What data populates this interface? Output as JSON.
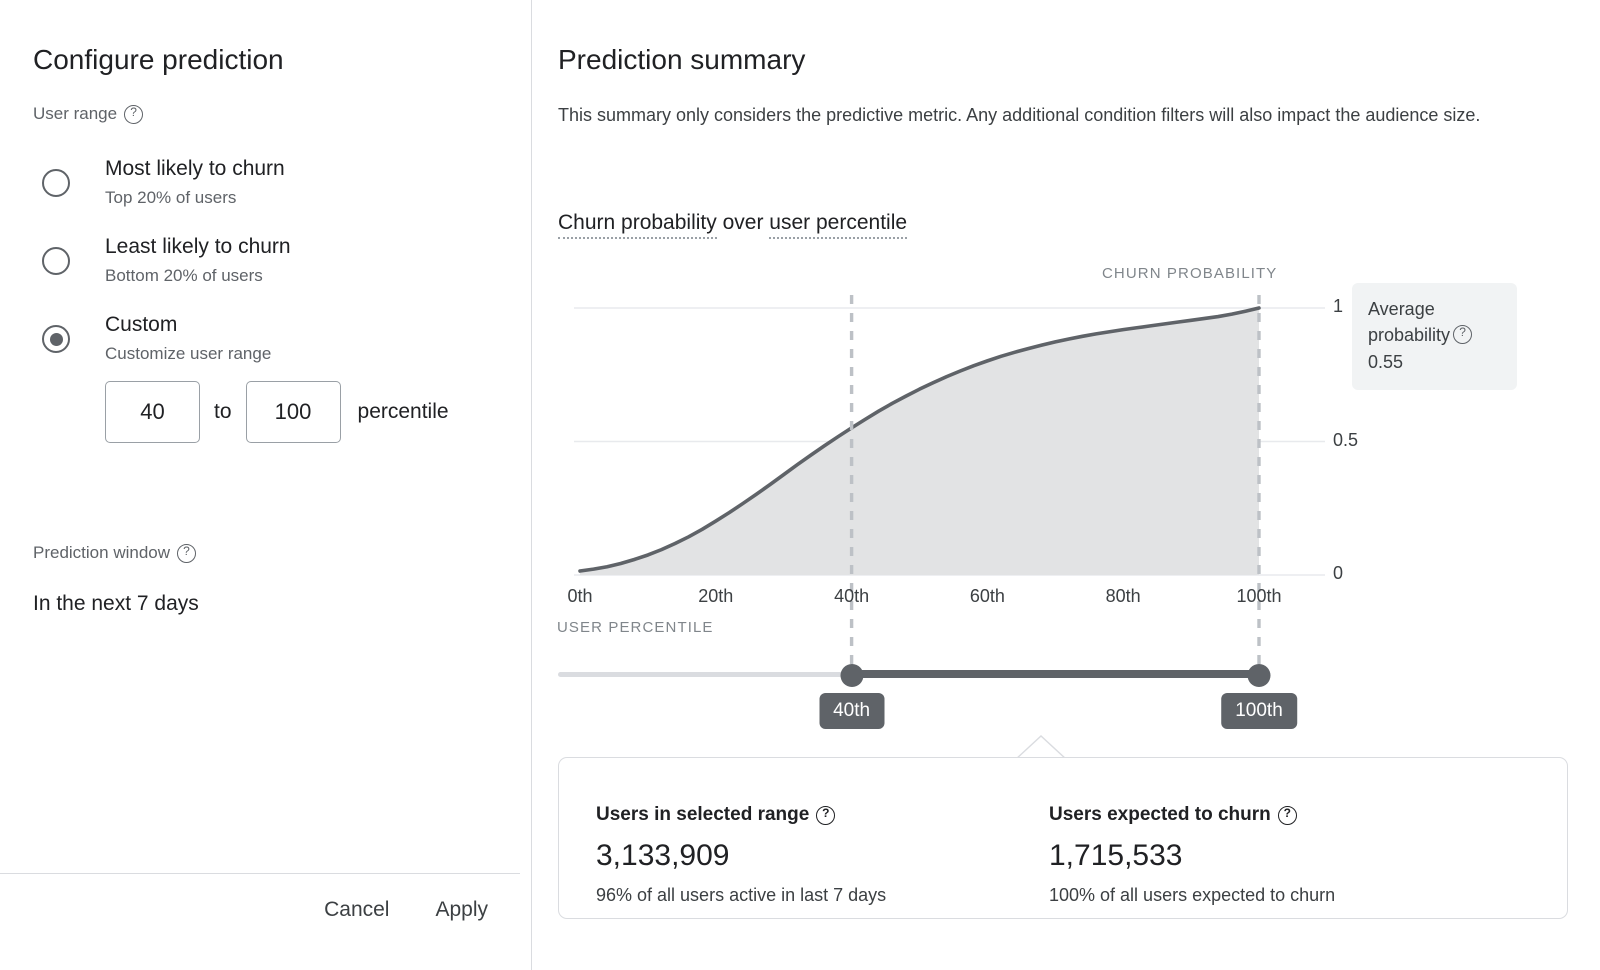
{
  "left": {
    "title": "Configure prediction",
    "user_range_label": "User range",
    "help_icon": "help-circle-icon",
    "options": [
      {
        "title": "Most likely to churn",
        "subtitle": "Top 20% of users",
        "selected": false
      },
      {
        "title": "Least likely to churn",
        "subtitle": "Bottom 20% of users",
        "selected": false
      },
      {
        "title": "Custom",
        "subtitle": "Customize user range",
        "selected": true
      }
    ],
    "range": {
      "from_value": "40",
      "to_word": "to",
      "to_value": "100",
      "unit_word": "percentile",
      "from_placeholder": "0",
      "to_placeholder": "100"
    },
    "prediction_window_label": "Prediction window",
    "prediction_window_value": "In the next 7 days",
    "cancel_label": "Cancel",
    "apply_label": "Apply"
  },
  "right": {
    "title": "Prediction summary",
    "description": "This summary only considers the predictive metric. Any additional condition filters will also impact the audience size.",
    "chart_title_part1": "Churn probability",
    "chart_title_mid": " over ",
    "chart_title_part2": "user percentile",
    "average_box": {
      "label_line1": "Average",
      "label_line2": "probability",
      "value": "0.55",
      "help_icon": "help-circle-icon"
    },
    "slider": {
      "low_label": "40th",
      "high_label": "100th",
      "low_value": 40,
      "high_value": 100,
      "min": 0,
      "max": 100
    },
    "stats": [
      {
        "heading": "Users in selected range",
        "value": "3,133,909",
        "subtext": "96% of all users active in last 7 days",
        "help_icon": "help-circle-icon"
      },
      {
        "heading": "Users expected to churn",
        "value": "1,715,533",
        "subtext": "100% of all users expected to churn",
        "help_icon": "help-circle-icon"
      }
    ]
  },
  "chart_data": {
    "type": "area",
    "title": "Churn probability over user percentile",
    "xlabel": "USER PERCENTILE",
    "ylabel": "CHURN PROBABILITY",
    "xlim": [
      0,
      100
    ],
    "ylim": [
      0,
      1.06
    ],
    "grid": true,
    "legend": "none",
    "xticks": [
      "0th",
      "20th",
      "40th",
      "60th",
      "80th",
      "100th"
    ],
    "xtick_values": [
      0,
      20,
      40,
      60,
      80,
      100
    ],
    "yticks": [
      "0",
      "0.5",
      "1"
    ],
    "ytick_values": [
      0,
      0.5,
      1
    ],
    "line_color": "#5f6368",
    "fill_color": "#e2e3e4",
    "marker_lines": [
      {
        "x": 40,
        "label": "40th",
        "style": "dashed"
      },
      {
        "x": 100,
        "label": "100th",
        "style": "dashed"
      }
    ],
    "annotations": [
      {
        "text": "Average probability 0.55",
        "value": 0.55
      }
    ],
    "x": [
      0,
      2,
      4,
      6,
      8,
      10,
      12,
      14,
      16,
      18,
      20,
      22,
      24,
      26,
      28,
      30,
      32,
      34,
      36,
      38,
      40,
      42,
      44,
      46,
      48,
      50,
      52,
      54,
      56,
      58,
      60,
      62,
      64,
      66,
      68,
      70,
      72,
      74,
      76,
      78,
      80,
      82,
      84,
      86,
      88,
      90,
      92,
      94,
      96,
      98,
      100
    ],
    "values": [
      0.015,
      0.022,
      0.031,
      0.043,
      0.058,
      0.075,
      0.095,
      0.118,
      0.143,
      0.171,
      0.202,
      0.234,
      0.268,
      0.303,
      0.339,
      0.376,
      0.413,
      0.449,
      0.484,
      0.518,
      0.551,
      0.583,
      0.614,
      0.643,
      0.67,
      0.696,
      0.72,
      0.743,
      0.764,
      0.784,
      0.802,
      0.819,
      0.834,
      0.848,
      0.861,
      0.873,
      0.884,
      0.894,
      0.903,
      0.911,
      0.919,
      0.926,
      0.933,
      0.94,
      0.947,
      0.954,
      0.961,
      0.968,
      0.977,
      0.988,
      1.0
    ]
  }
}
